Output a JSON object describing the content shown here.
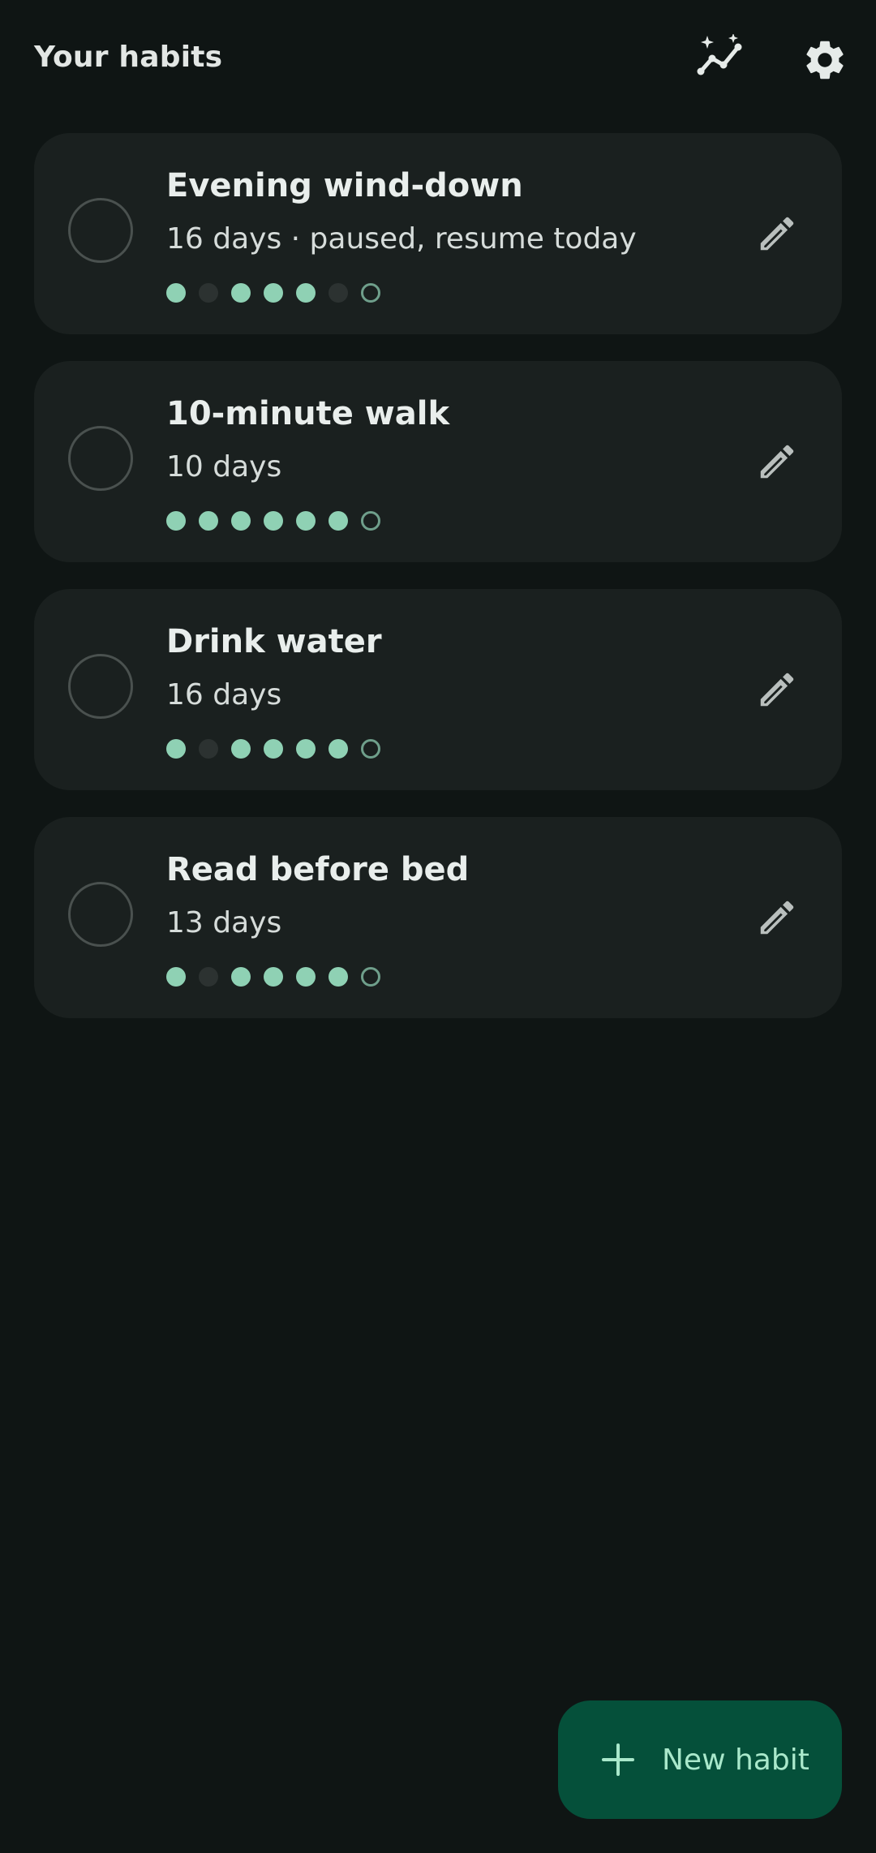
{
  "header": {
    "title": "Your habits",
    "stats_icon": "stats-sparkle-icon",
    "settings_icon": "gear-icon"
  },
  "habits": [
    {
      "name": "Evening wind-down",
      "subtitle": "16 days · paused, resume today",
      "week": [
        "done",
        "miss",
        "done",
        "done",
        "done",
        "miss",
        "today"
      ]
    },
    {
      "name": "10-minute walk",
      "subtitle": "10 days",
      "week": [
        "done",
        "done",
        "done",
        "done",
        "done",
        "done",
        "today"
      ]
    },
    {
      "name": "Drink water",
      "subtitle": "16 days",
      "week": [
        "done",
        "miss",
        "done",
        "done",
        "done",
        "done",
        "today"
      ]
    },
    {
      "name": "Read before bed",
      "subtitle": "13 days",
      "week": [
        "done",
        "miss",
        "done",
        "done",
        "done",
        "done",
        "today"
      ]
    }
  ],
  "fab": {
    "label": "New habit",
    "icon": "plus-icon"
  },
  "colors": {
    "background": "#0f1514",
    "card": "#1a201f",
    "accent": "#8fd1b4",
    "fab": "#05503a"
  }
}
